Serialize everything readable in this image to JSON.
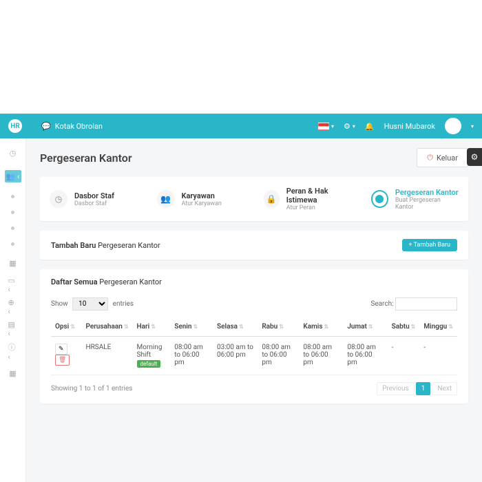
{
  "header": {
    "logo_text": "HR",
    "chat_label": "Kotak Obrolan",
    "user_name": "Husni Mubarok"
  },
  "page": {
    "title": "Pergeseran Kantor",
    "logout_label": "Keluar"
  },
  "breadcrumb": [
    {
      "title": "Dasbor Staf",
      "sub": "Dasbor Staf"
    },
    {
      "title": "Karyawan",
      "sub": "Atur Karyawan"
    },
    {
      "title": "Peran & Hak Istimewa",
      "sub": "Atur Peran"
    },
    {
      "title": "Pergeseran Kantor",
      "sub": "Buat Pergeseran Kantor"
    }
  ],
  "add_panel": {
    "title_bold": "Tambah Baru",
    "title_rest": "Pergeseran Kantor",
    "btn": "+ Tambah Baru"
  },
  "list": {
    "title_bold": "Daftar Semua",
    "title_rest": "Pergeseran Kantor",
    "show": "Show",
    "entries": "entries",
    "page_size": "10",
    "search": "Search:",
    "cols": [
      "Opsi",
      "Perusahaan",
      "Hari",
      "Senin",
      "Selasa",
      "Rabu",
      "Kamis",
      "Jumat",
      "Sabtu",
      "Minggu"
    ],
    "row": {
      "perusahaan": "HRSALE",
      "hari": "Morning Shift",
      "badge": "default",
      "senin": "08:00 am to 06:00 pm",
      "selasa": "03:00 am to 06:00 pm",
      "rabu": "08:00 am to 06:00 pm",
      "kamis": "08:00 am to 06:00 pm",
      "jumat": "08:00 am to 06:00 pm",
      "sabtu": "-",
      "minggu": "-"
    },
    "info": "Showing 1 to 1 of 1 entries",
    "prev": "Previous",
    "page": "1",
    "next": "Next"
  }
}
